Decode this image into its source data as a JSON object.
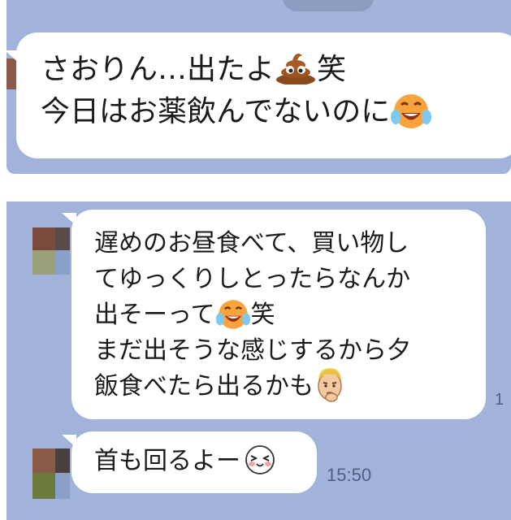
{
  "messages": [
    {
      "lines": [
        "さおりん…出たよ",
        "今日はお薬飲んでないのに"
      ],
      "line1_suffix": "笑",
      "emojis": [
        "poop-emoji",
        "laughing-tears-emoji"
      ]
    },
    {
      "lines": [
        "遅めのお昼食べて、買い物し",
        "てゆっくりしとったらなんか",
        "出そーって",
        "まだ出そうな感じするから夕",
        "飯食べたら出るかも"
      ],
      "line3_suffix": "笑",
      "emojis": [
        "laughing-tears-emoji",
        "thinking-man-emoji"
      ]
    },
    {
      "lines": [
        "首も回るよー"
      ],
      "emojis": [
        "happy-face-emoji"
      ],
      "time": "15:50"
    }
  ],
  "edge_text": "1",
  "colors": {
    "chat_background": "#a1b3db",
    "bubble": "#ffffff",
    "text": "#1a1a1a",
    "timestamp": "#50607f"
  }
}
